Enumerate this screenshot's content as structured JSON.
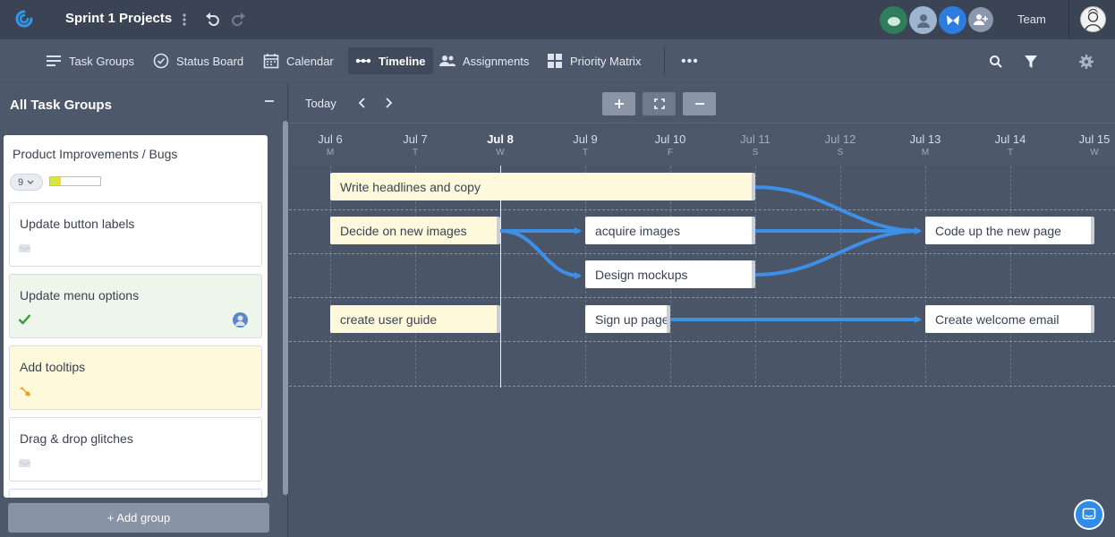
{
  "header": {
    "project_title": "Sprint 1 Projects",
    "team_label": "Team",
    "accent_color": "#2d7de0"
  },
  "nav": {
    "tabs": [
      {
        "label": "Task Groups",
        "icon": "list-icon"
      },
      {
        "label": "Status Board",
        "icon": "check-circle-icon"
      },
      {
        "label": "Calendar",
        "icon": "calendar-icon"
      },
      {
        "label": "Timeline",
        "icon": "timeline-icon",
        "active": true
      },
      {
        "label": "Assignments",
        "icon": "people-icon"
      },
      {
        "label": "Priority Matrix",
        "icon": "grid-icon"
      }
    ],
    "more_label": "•••"
  },
  "sidebar": {
    "title": "All Task Groups",
    "group": {
      "name": "Product Improvements / Bugs",
      "count": "9",
      "progress_done": 0.12,
      "progress_in_progress": 0.1
    },
    "tasks": [
      {
        "title": "Update button labels",
        "status": "inbox-icon",
        "bg": "#ffffff"
      },
      {
        "title": "Update menu options",
        "status": "check-icon",
        "bg": "#eef5ea",
        "assignee": true
      },
      {
        "title": "Add tooltips",
        "status": "wrench-icon",
        "bg": "#fff9dc"
      },
      {
        "title": "Drag & drop glitches",
        "status": "inbox-icon",
        "bg": "#ffffff"
      }
    ],
    "add_group_label": "+ Add group"
  },
  "timeline": {
    "today_label": "Today",
    "dates": [
      {
        "label": "Jul 6",
        "dow": "M"
      },
      {
        "label": "Jul 7",
        "dow": "T"
      },
      {
        "label": "Jul 8",
        "dow": "W",
        "today": true
      },
      {
        "label": "Jul 9",
        "dow": "T"
      },
      {
        "label": "Jul 10",
        "dow": "F"
      },
      {
        "label": "Jul 11",
        "dow": "S",
        "weekend": true
      },
      {
        "label": "Jul 12",
        "dow": "S",
        "weekend": true
      },
      {
        "label": "Jul 13",
        "dow": "M"
      },
      {
        "label": "Jul 14",
        "dow": "T"
      },
      {
        "label": "Jul 15",
        "dow": "W"
      }
    ],
    "bars": [
      {
        "label": "Write headlines and copy",
        "color": "yellow"
      },
      {
        "label": "Decide on new images",
        "color": "yellow"
      },
      {
        "label": "acquire images",
        "color": "white"
      },
      {
        "label": "Code up the new page",
        "color": "white"
      },
      {
        "label": "Design mockups",
        "color": "white"
      },
      {
        "label": "create user guide",
        "color": "yellow"
      },
      {
        "label": "Sign up page",
        "color": "white"
      },
      {
        "label": "Create welcome email",
        "color": "white"
      }
    ]
  }
}
